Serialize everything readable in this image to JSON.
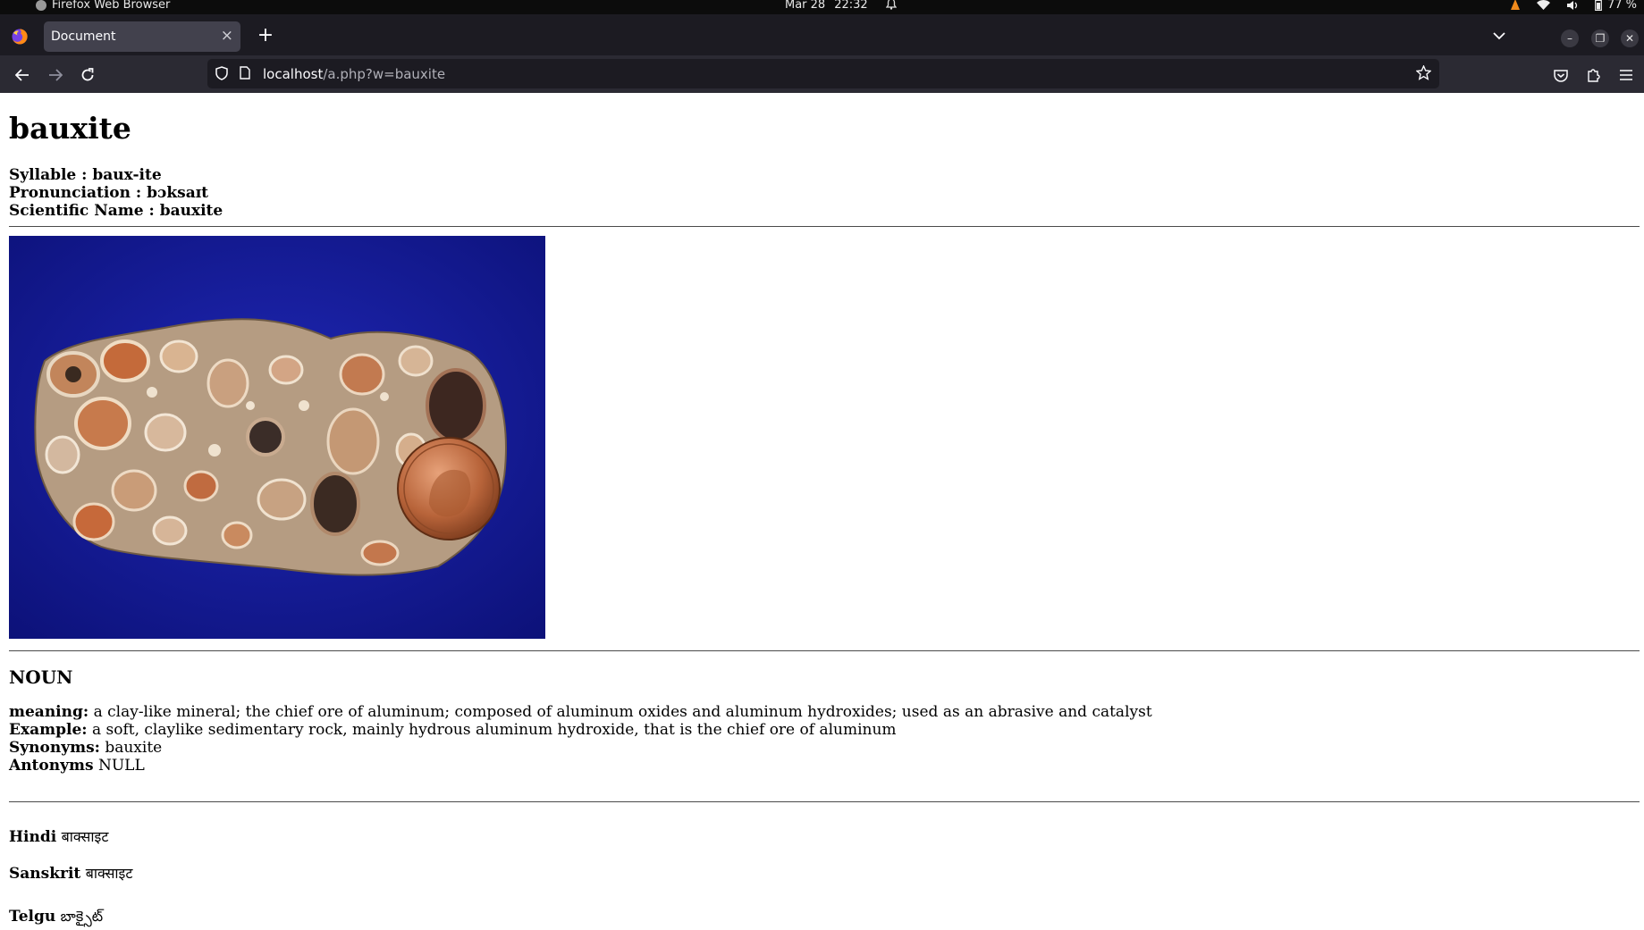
{
  "system_bar": {
    "app_name": "Firefox Web Browser",
    "date": "Mar 28",
    "time": "22:32",
    "battery": "77 %"
  },
  "browser": {
    "tab_title": "Document",
    "url_host": "localhost",
    "url_path": "/a.php?w=bauxite",
    "accent_color": "#1c1b22"
  },
  "entry": {
    "word": "bauxite",
    "syllable_label": "Syllable :",
    "syllable": "baux-ite",
    "pronunciation_label": "Pronunciation :",
    "pronunciation": "bɔksaɪt",
    "scientific_label": "Scientific Name :",
    "scientific_name": "bauxite",
    "part_of_speech": "NOUN",
    "meaning_label": "meaning:",
    "meaning": "a clay-like mineral; the chief ore of aluminum; composed of aluminum oxides and aluminum hydroxides; used as an abrasive and catalyst",
    "example_label": "Example:",
    "example": "a soft, claylike sedimentary rock, mainly hydrous aluminum hydroxide, that is the chief ore of aluminum",
    "synonyms_label": "Synonyms:",
    "synonyms": "bauxite",
    "antonyms_label": "Antonyms",
    "antonyms": "NULL"
  },
  "translations": [
    {
      "language": "Hindi",
      "text": "बाक्साइट"
    },
    {
      "language": "Sanskrit",
      "text": "बाक्साइट"
    },
    {
      "language": "Telgu",
      "text": "బాక్సైట్"
    }
  ]
}
